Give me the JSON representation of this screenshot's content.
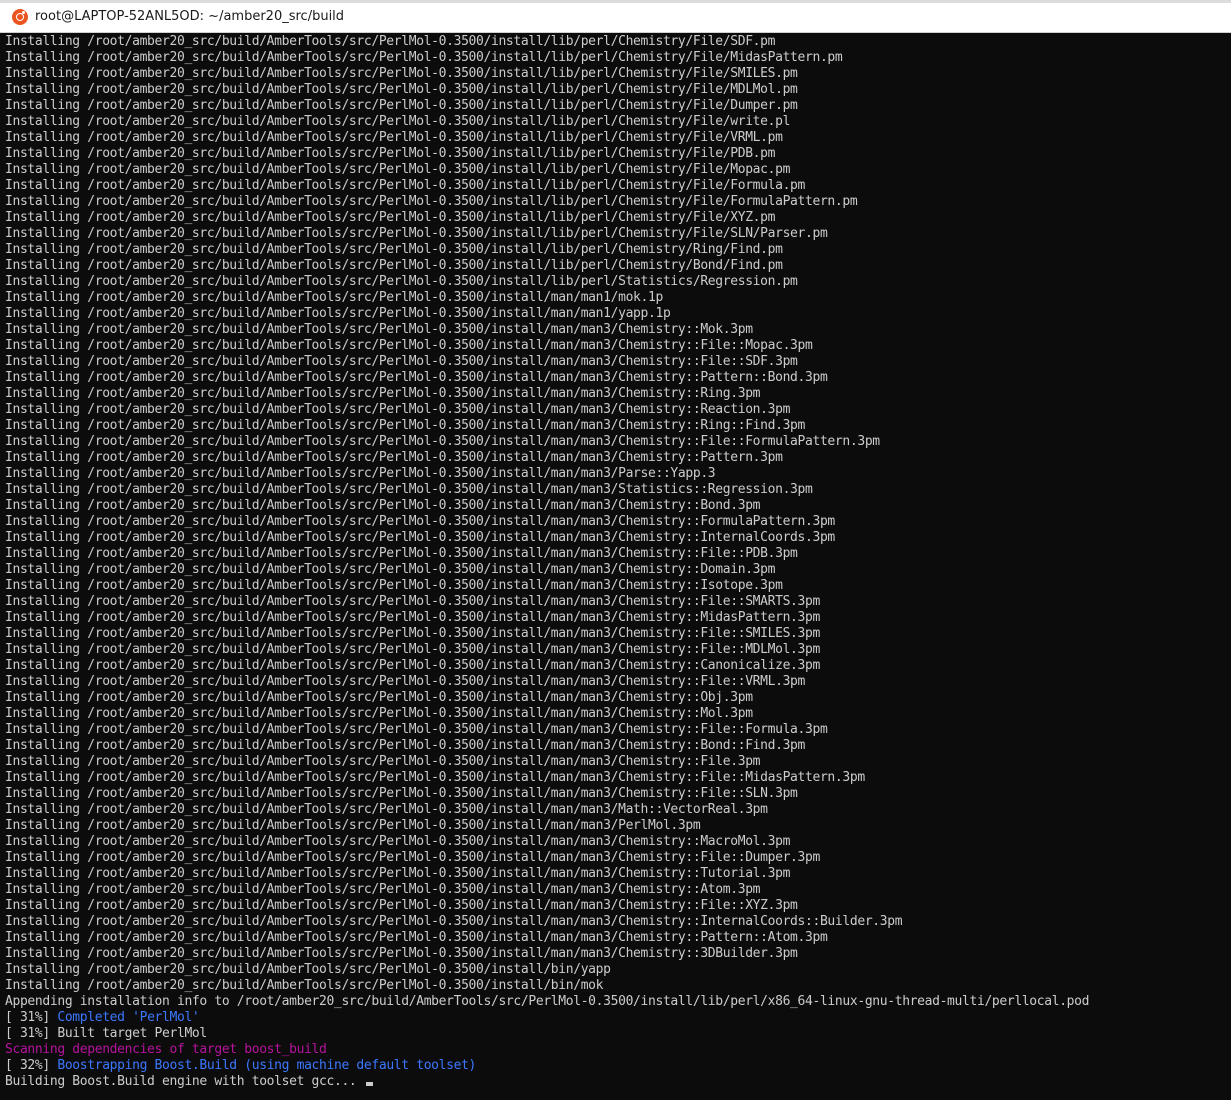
{
  "window": {
    "title": "root@LAPTOP-52ANL5OD: ~/amber20_src/build",
    "icon": "ubuntu-icon"
  },
  "colors": {
    "background": "#0c0c0c",
    "text": "#cccccc",
    "completed": "#3b78ff",
    "scanning": "#b5139c"
  },
  "terminal": {
    "lines": [
      {
        "text": "Installing /root/amber20_src/build/AmberTools/src/PerlMol-0.3500/install/lib/perl/Chemistry/File/SDF.pm"
      },
      {
        "text": "Installing /root/amber20_src/build/AmberTools/src/PerlMol-0.3500/install/lib/perl/Chemistry/File/MidasPattern.pm"
      },
      {
        "text": "Installing /root/amber20_src/build/AmberTools/src/PerlMol-0.3500/install/lib/perl/Chemistry/File/SMILES.pm"
      },
      {
        "text": "Installing /root/amber20_src/build/AmberTools/src/PerlMol-0.3500/install/lib/perl/Chemistry/File/MDLMol.pm"
      },
      {
        "text": "Installing /root/amber20_src/build/AmberTools/src/PerlMol-0.3500/install/lib/perl/Chemistry/File/Dumper.pm"
      },
      {
        "text": "Installing /root/amber20_src/build/AmberTools/src/PerlMol-0.3500/install/lib/perl/Chemistry/File/write.pl"
      },
      {
        "text": "Installing /root/amber20_src/build/AmberTools/src/PerlMol-0.3500/install/lib/perl/Chemistry/File/VRML.pm"
      },
      {
        "text": "Installing /root/amber20_src/build/AmberTools/src/PerlMol-0.3500/install/lib/perl/Chemistry/File/PDB.pm"
      },
      {
        "text": "Installing /root/amber20_src/build/AmberTools/src/PerlMol-0.3500/install/lib/perl/Chemistry/File/Mopac.pm"
      },
      {
        "text": "Installing /root/amber20_src/build/AmberTools/src/PerlMol-0.3500/install/lib/perl/Chemistry/File/Formula.pm"
      },
      {
        "text": "Installing /root/amber20_src/build/AmberTools/src/PerlMol-0.3500/install/lib/perl/Chemistry/File/FormulaPattern.pm"
      },
      {
        "text": "Installing /root/amber20_src/build/AmberTools/src/PerlMol-0.3500/install/lib/perl/Chemistry/File/XYZ.pm"
      },
      {
        "text": "Installing /root/amber20_src/build/AmberTools/src/PerlMol-0.3500/install/lib/perl/Chemistry/File/SLN/Parser.pm"
      },
      {
        "text": "Installing /root/amber20_src/build/AmberTools/src/PerlMol-0.3500/install/lib/perl/Chemistry/Ring/Find.pm"
      },
      {
        "text": "Installing /root/amber20_src/build/AmberTools/src/PerlMol-0.3500/install/lib/perl/Chemistry/Bond/Find.pm"
      },
      {
        "text": "Installing /root/amber20_src/build/AmberTools/src/PerlMol-0.3500/install/lib/perl/Statistics/Regression.pm"
      },
      {
        "text": "Installing /root/amber20_src/build/AmberTools/src/PerlMol-0.3500/install/man/man1/mok.1p"
      },
      {
        "text": "Installing /root/amber20_src/build/AmberTools/src/PerlMol-0.3500/install/man/man1/yapp.1p"
      },
      {
        "text": "Installing /root/amber20_src/build/AmberTools/src/PerlMol-0.3500/install/man/man3/Chemistry::Mok.3pm"
      },
      {
        "text": "Installing /root/amber20_src/build/AmberTools/src/PerlMol-0.3500/install/man/man3/Chemistry::File::Mopac.3pm"
      },
      {
        "text": "Installing /root/amber20_src/build/AmberTools/src/PerlMol-0.3500/install/man/man3/Chemistry::File::SDF.3pm"
      },
      {
        "text": "Installing /root/amber20_src/build/AmberTools/src/PerlMol-0.3500/install/man/man3/Chemistry::Pattern::Bond.3pm"
      },
      {
        "text": "Installing /root/amber20_src/build/AmberTools/src/PerlMol-0.3500/install/man/man3/Chemistry::Ring.3pm"
      },
      {
        "text": "Installing /root/amber20_src/build/AmberTools/src/PerlMol-0.3500/install/man/man3/Chemistry::Reaction.3pm"
      },
      {
        "text": "Installing /root/amber20_src/build/AmberTools/src/PerlMol-0.3500/install/man/man3/Chemistry::Ring::Find.3pm"
      },
      {
        "text": "Installing /root/amber20_src/build/AmberTools/src/PerlMol-0.3500/install/man/man3/Chemistry::File::FormulaPattern.3pm"
      },
      {
        "text": "Installing /root/amber20_src/build/AmberTools/src/PerlMol-0.3500/install/man/man3/Chemistry::Pattern.3pm"
      },
      {
        "text": "Installing /root/amber20_src/build/AmberTools/src/PerlMol-0.3500/install/man/man3/Parse::Yapp.3"
      },
      {
        "text": "Installing /root/amber20_src/build/AmberTools/src/PerlMol-0.3500/install/man/man3/Statistics::Regression.3pm"
      },
      {
        "text": "Installing /root/amber20_src/build/AmberTools/src/PerlMol-0.3500/install/man/man3/Chemistry::Bond.3pm"
      },
      {
        "text": "Installing /root/amber20_src/build/AmberTools/src/PerlMol-0.3500/install/man/man3/Chemistry::FormulaPattern.3pm"
      },
      {
        "text": "Installing /root/amber20_src/build/AmberTools/src/PerlMol-0.3500/install/man/man3/Chemistry::InternalCoords.3pm"
      },
      {
        "text": "Installing /root/amber20_src/build/AmberTools/src/PerlMol-0.3500/install/man/man3/Chemistry::File::PDB.3pm"
      },
      {
        "text": "Installing /root/amber20_src/build/AmberTools/src/PerlMol-0.3500/install/man/man3/Chemistry::Domain.3pm"
      },
      {
        "text": "Installing /root/amber20_src/build/AmberTools/src/PerlMol-0.3500/install/man/man3/Chemistry::Isotope.3pm"
      },
      {
        "text": "Installing /root/amber20_src/build/AmberTools/src/PerlMol-0.3500/install/man/man3/Chemistry::File::SMARTS.3pm"
      },
      {
        "text": "Installing /root/amber20_src/build/AmberTools/src/PerlMol-0.3500/install/man/man3/Chemistry::MidasPattern.3pm"
      },
      {
        "text": "Installing /root/amber20_src/build/AmberTools/src/PerlMol-0.3500/install/man/man3/Chemistry::File::SMILES.3pm"
      },
      {
        "text": "Installing /root/amber20_src/build/AmberTools/src/PerlMol-0.3500/install/man/man3/Chemistry::File::MDLMol.3pm"
      },
      {
        "text": "Installing /root/amber20_src/build/AmberTools/src/PerlMol-0.3500/install/man/man3/Chemistry::Canonicalize.3pm"
      },
      {
        "text": "Installing /root/amber20_src/build/AmberTools/src/PerlMol-0.3500/install/man/man3/Chemistry::File::VRML.3pm"
      },
      {
        "text": "Installing /root/amber20_src/build/AmberTools/src/PerlMol-0.3500/install/man/man3/Chemistry::Obj.3pm"
      },
      {
        "text": "Installing /root/amber20_src/build/AmberTools/src/PerlMol-0.3500/install/man/man3/Chemistry::Mol.3pm"
      },
      {
        "text": "Installing /root/amber20_src/build/AmberTools/src/PerlMol-0.3500/install/man/man3/Chemistry::File::Formula.3pm"
      },
      {
        "text": "Installing /root/amber20_src/build/AmberTools/src/PerlMol-0.3500/install/man/man3/Chemistry::Bond::Find.3pm"
      },
      {
        "text": "Installing /root/amber20_src/build/AmberTools/src/PerlMol-0.3500/install/man/man3/Chemistry::File.3pm"
      },
      {
        "text": "Installing /root/amber20_src/build/AmberTools/src/PerlMol-0.3500/install/man/man3/Chemistry::File::MidasPattern.3pm"
      },
      {
        "text": "Installing /root/amber20_src/build/AmberTools/src/PerlMol-0.3500/install/man/man3/Chemistry::File::SLN.3pm"
      },
      {
        "text": "Installing /root/amber20_src/build/AmberTools/src/PerlMol-0.3500/install/man/man3/Math::VectorReal.3pm"
      },
      {
        "text": "Installing /root/amber20_src/build/AmberTools/src/PerlMol-0.3500/install/man/man3/PerlMol.3pm"
      },
      {
        "text": "Installing /root/amber20_src/build/AmberTools/src/PerlMol-0.3500/install/man/man3/Chemistry::MacroMol.3pm"
      },
      {
        "text": "Installing /root/amber20_src/build/AmberTools/src/PerlMol-0.3500/install/man/man3/Chemistry::File::Dumper.3pm"
      },
      {
        "text": "Installing /root/amber20_src/build/AmberTools/src/PerlMol-0.3500/install/man/man3/Chemistry::Tutorial.3pm"
      },
      {
        "text": "Installing /root/amber20_src/build/AmberTools/src/PerlMol-0.3500/install/man/man3/Chemistry::Atom.3pm"
      },
      {
        "text": "Installing /root/amber20_src/build/AmberTools/src/PerlMol-0.3500/install/man/man3/Chemistry::File::XYZ.3pm"
      },
      {
        "text": "Installing /root/amber20_src/build/AmberTools/src/PerlMol-0.3500/install/man/man3/Chemistry::InternalCoords::Builder.3pm"
      },
      {
        "text": "Installing /root/amber20_src/build/AmberTools/src/PerlMol-0.3500/install/man/man3/Chemistry::Pattern::Atom.3pm"
      },
      {
        "text": "Installing /root/amber20_src/build/AmberTools/src/PerlMol-0.3500/install/man/man3/Chemistry::3DBuilder.3pm"
      },
      {
        "text": "Installing /root/amber20_src/build/AmberTools/src/PerlMol-0.3500/install/bin/yapp"
      },
      {
        "text": "Installing /root/amber20_src/build/AmberTools/src/PerlMol-0.3500/install/bin/mok"
      },
      {
        "text": "Appending installation info to /root/amber20_src/build/AmberTools/src/PerlMol-0.3500/install/lib/perl/x86_64-linux-gnu-thread-multi/perllocal.pod"
      },
      {
        "prefix": "[ 31%] ",
        "text": "Completed 'PerlMol'",
        "style": "blue"
      },
      {
        "text": "[ 31%] Built target PerlMol"
      },
      {
        "text": "Scanning dependencies of target boost_build",
        "style": "magenta"
      },
      {
        "prefix": "[ 32%] ",
        "text": "Boostrapping Boost.Build (using machine default toolset)",
        "style": "blue"
      },
      {
        "text": "Building Boost.Build engine with toolset gcc... ",
        "cursor": true
      }
    ]
  }
}
